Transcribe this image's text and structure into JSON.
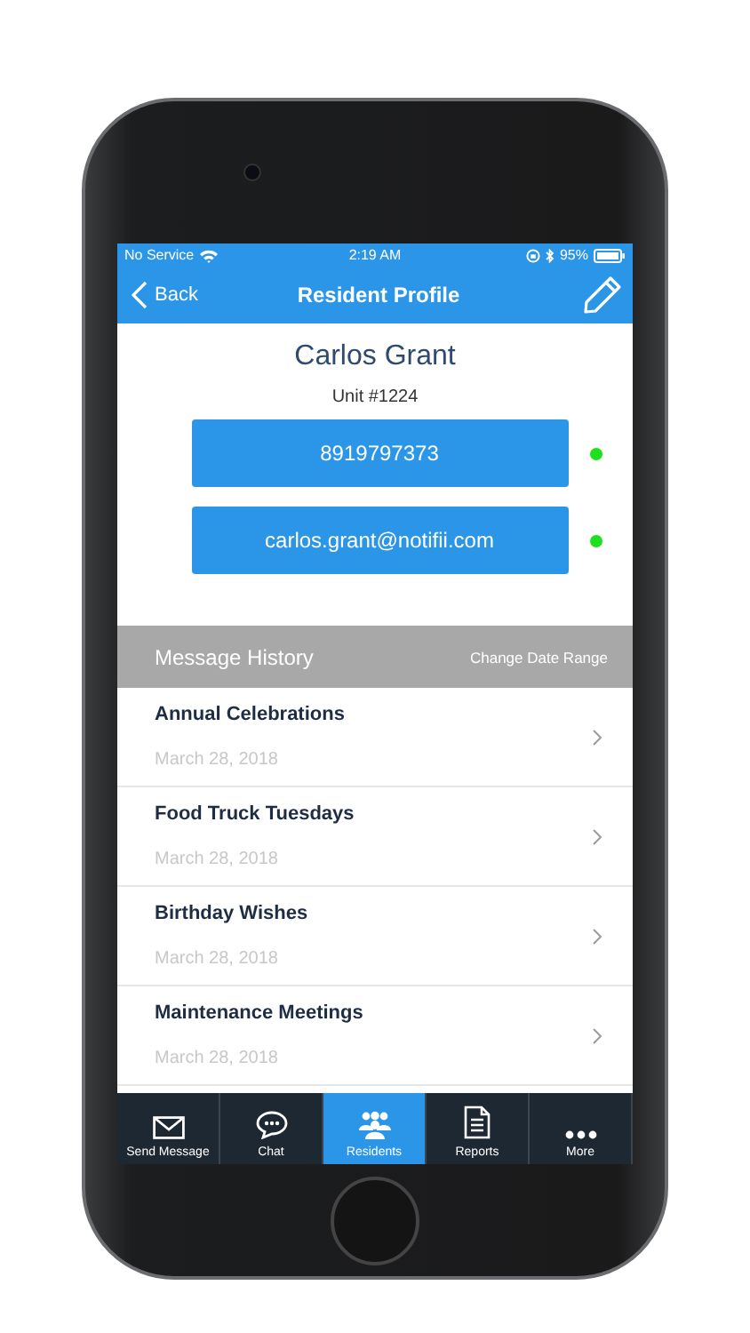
{
  "status_bar": {
    "carrier": "No Service",
    "time": "2:19 AM",
    "battery": "95%"
  },
  "nav": {
    "back": "Back",
    "title": "Resident Profile"
  },
  "profile": {
    "name": "Carlos Grant",
    "unit": "Unit #1224",
    "contacts": [
      {
        "value": "8919797373",
        "color": "#1ee01e"
      },
      {
        "value": "carlos.grant@notifii.com",
        "color": "#1ee01e"
      }
    ]
  },
  "history": {
    "title": "Message History",
    "action": "Change Date Range",
    "messages": [
      {
        "title": "Annual Celebrations",
        "date": "March 28, 2018"
      },
      {
        "title": "Food Truck Tuesdays",
        "date": "March 28, 2018"
      },
      {
        "title": "Birthday Wishes",
        "date": "March 28, 2018"
      },
      {
        "title": "Maintenance Meetings",
        "date": "March 28, 2018"
      }
    ]
  },
  "tab_bar": [
    {
      "label": "Send Message",
      "selected": false
    },
    {
      "label": "Chat",
      "selected": false
    },
    {
      "label": "Residents",
      "selected": true
    },
    {
      "label": "Reports",
      "selected": false
    },
    {
      "label": "More",
      "selected": false
    }
  ]
}
